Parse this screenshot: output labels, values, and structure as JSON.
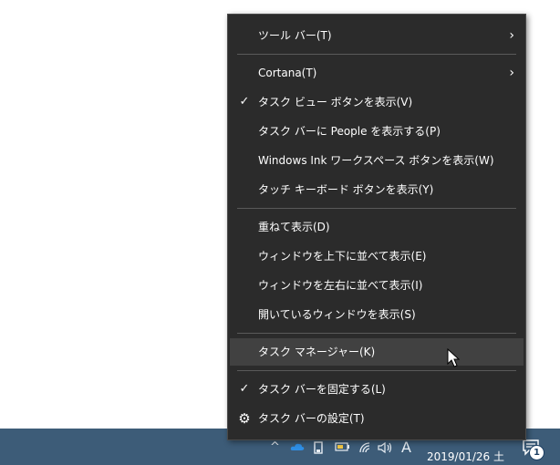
{
  "menu": {
    "items": [
      {
        "label": "ツール バー(T)",
        "submenu": true,
        "checked": false
      },
      {
        "label": "Cortana(T)",
        "submenu": true,
        "checked": false
      },
      {
        "label": "タスク ビュー ボタンを表示(V)",
        "submenu": false,
        "checked": true
      },
      {
        "label": "タスク バーに People を表示する(P)",
        "submenu": false,
        "checked": false
      },
      {
        "label": "Windows Ink ワークスペース ボタンを表示(W)",
        "submenu": false,
        "checked": false
      },
      {
        "label": "タッチ キーボード ボタンを表示(Y)",
        "submenu": false,
        "checked": false
      },
      {
        "label": "重ねて表示(D)",
        "submenu": false,
        "checked": false
      },
      {
        "label": "ウィンドウを上下に並べて表示(E)",
        "submenu": false,
        "checked": false
      },
      {
        "label": "ウィンドウを左右に並べて表示(I)",
        "submenu": false,
        "checked": false
      },
      {
        "label": "開いているウィンドウを表示(S)",
        "submenu": false,
        "checked": false
      },
      {
        "label": "タスク マネージャー(K)",
        "submenu": false,
        "checked": false,
        "hovered": true
      },
      {
        "label": "タスク バーを固定する(L)",
        "submenu": false,
        "checked": true
      },
      {
        "label": "タスク バーの設定(T)",
        "submenu": false,
        "checked": false,
        "icon": "gear-icon"
      }
    ],
    "check_glyph": "✓",
    "arrow_glyph": "›",
    "gear_glyph": "⚙"
  },
  "taskbar": {
    "tray_chevron": "^",
    "ime_label": "A",
    "date": "2019/01/26 土",
    "notification_count": "1"
  },
  "colors": {
    "menu_bg": "#2b2b2b",
    "menu_hover": "#414141",
    "taskbar_bg": "#3d5c78"
  }
}
